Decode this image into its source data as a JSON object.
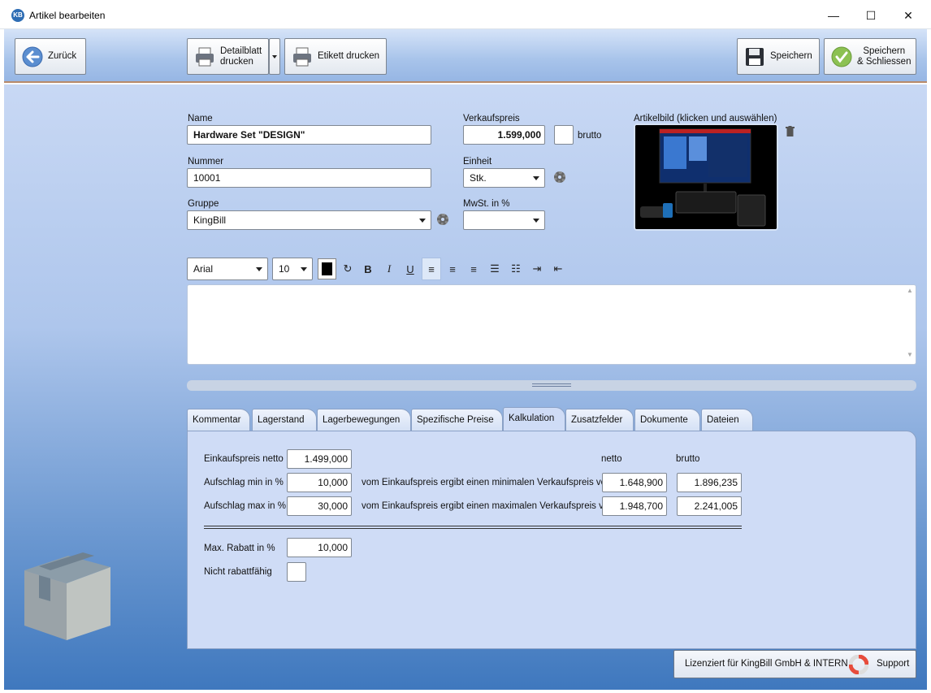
{
  "window": {
    "title": "Artikel bearbeiten",
    "logo": "KB",
    "minimize": "—",
    "maximize": "☐",
    "close": "✕"
  },
  "toolbar": {
    "back_label": "Zurück",
    "detail_label": "Detailblatt\ndrucken",
    "label_print": "Etikett drucken",
    "save_label": "Speichern",
    "save_close_label": "Speichern\n& Schliessen"
  },
  "form": {
    "name_label": "Name",
    "name_value": "Hardware Set \"DESIGN\"",
    "number_label": "Nummer",
    "number_value": "10001",
    "group_label": "Gruppe",
    "group_value": "KingBill",
    "price_label": "Verkaufspreis",
    "price_value": "1.599,000",
    "brutto_label": "brutto",
    "unit_label": "Einheit",
    "unit_value": "Stk.",
    "vat_label": "MwSt. in %",
    "vat_value": "",
    "image_label": "Artikelbild (klicken und auswählen)"
  },
  "editor": {
    "font": "Arial",
    "size": "10",
    "bold": "B",
    "italic": "I",
    "underline": "U"
  },
  "tabs": [
    {
      "label": "Kommentar"
    },
    {
      "label": "Lagerstand"
    },
    {
      "label": "Lagerbewegungen"
    },
    {
      "label": "Spezifische Preise"
    },
    {
      "label": "Kalkulation"
    },
    {
      "label": "Zusatzfelder"
    },
    {
      "label": "Dokumente"
    },
    {
      "label": "Dateien"
    }
  ],
  "calc": {
    "purchase_label": "Einkaufspreis netto",
    "purchase_value": "1.499,000",
    "netto_header": "netto",
    "brutto_header": "brutto",
    "min_label": "Aufschlag min in %",
    "min_value": "10,000",
    "min_text": "vom Einkaufspreis ergibt einen minimalen Verkaufspreis von",
    "min_netto": "1.648,900",
    "min_brutto": "1.896,235",
    "max_label": "Aufschlag max in %",
    "max_value": "30,000",
    "max_text": "vom Einkaufspreis ergibt einen maximalen Verkaufspreis von",
    "max_netto": "1.948,700",
    "max_brutto": "2.241,005",
    "discount_label": "Max. Rabatt in %",
    "discount_value": "10,000",
    "non_discount_label": "Nicht rabattfähig"
  },
  "footer": {
    "license": "Lizenziert für KingBill GmbH & INTERN",
    "support": "Support"
  }
}
